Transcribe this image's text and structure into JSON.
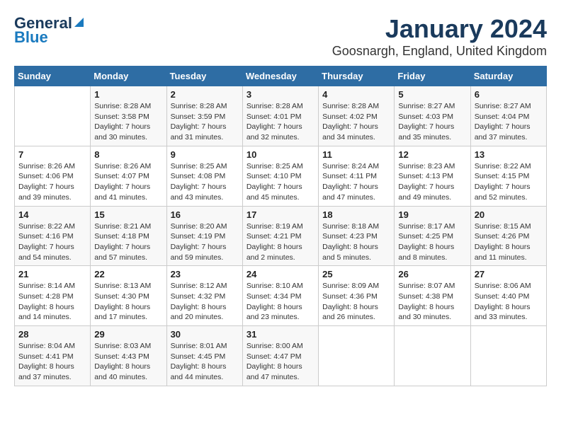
{
  "logo": {
    "line1": "General",
    "line2": "Blue"
  },
  "title": "January 2024",
  "subtitle": "Goosnargh, England, United Kingdom",
  "weekdays": [
    "Sunday",
    "Monday",
    "Tuesday",
    "Wednesday",
    "Thursday",
    "Friday",
    "Saturday"
  ],
  "weeks": [
    [
      {
        "day": "",
        "sunrise": "",
        "sunset": "",
        "daylight": ""
      },
      {
        "day": "1",
        "sunrise": "Sunrise: 8:28 AM",
        "sunset": "Sunset: 3:58 PM",
        "daylight": "Daylight: 7 hours and 30 minutes."
      },
      {
        "day": "2",
        "sunrise": "Sunrise: 8:28 AM",
        "sunset": "Sunset: 3:59 PM",
        "daylight": "Daylight: 7 hours and 31 minutes."
      },
      {
        "day": "3",
        "sunrise": "Sunrise: 8:28 AM",
        "sunset": "Sunset: 4:01 PM",
        "daylight": "Daylight: 7 hours and 32 minutes."
      },
      {
        "day": "4",
        "sunrise": "Sunrise: 8:28 AM",
        "sunset": "Sunset: 4:02 PM",
        "daylight": "Daylight: 7 hours and 34 minutes."
      },
      {
        "day": "5",
        "sunrise": "Sunrise: 8:27 AM",
        "sunset": "Sunset: 4:03 PM",
        "daylight": "Daylight: 7 hours and 35 minutes."
      },
      {
        "day": "6",
        "sunrise": "Sunrise: 8:27 AM",
        "sunset": "Sunset: 4:04 PM",
        "daylight": "Daylight: 7 hours and 37 minutes."
      }
    ],
    [
      {
        "day": "7",
        "sunrise": "Sunrise: 8:26 AM",
        "sunset": "Sunset: 4:06 PM",
        "daylight": "Daylight: 7 hours and 39 minutes."
      },
      {
        "day": "8",
        "sunrise": "Sunrise: 8:26 AM",
        "sunset": "Sunset: 4:07 PM",
        "daylight": "Daylight: 7 hours and 41 minutes."
      },
      {
        "day": "9",
        "sunrise": "Sunrise: 8:25 AM",
        "sunset": "Sunset: 4:08 PM",
        "daylight": "Daylight: 7 hours and 43 minutes."
      },
      {
        "day": "10",
        "sunrise": "Sunrise: 8:25 AM",
        "sunset": "Sunset: 4:10 PM",
        "daylight": "Daylight: 7 hours and 45 minutes."
      },
      {
        "day": "11",
        "sunrise": "Sunrise: 8:24 AM",
        "sunset": "Sunset: 4:11 PM",
        "daylight": "Daylight: 7 hours and 47 minutes."
      },
      {
        "day": "12",
        "sunrise": "Sunrise: 8:23 AM",
        "sunset": "Sunset: 4:13 PM",
        "daylight": "Daylight: 7 hours and 49 minutes."
      },
      {
        "day": "13",
        "sunrise": "Sunrise: 8:22 AM",
        "sunset": "Sunset: 4:15 PM",
        "daylight": "Daylight: 7 hours and 52 minutes."
      }
    ],
    [
      {
        "day": "14",
        "sunrise": "Sunrise: 8:22 AM",
        "sunset": "Sunset: 4:16 PM",
        "daylight": "Daylight: 7 hours and 54 minutes."
      },
      {
        "day": "15",
        "sunrise": "Sunrise: 8:21 AM",
        "sunset": "Sunset: 4:18 PM",
        "daylight": "Daylight: 7 hours and 57 minutes."
      },
      {
        "day": "16",
        "sunrise": "Sunrise: 8:20 AM",
        "sunset": "Sunset: 4:19 PM",
        "daylight": "Daylight: 7 hours and 59 minutes."
      },
      {
        "day": "17",
        "sunrise": "Sunrise: 8:19 AM",
        "sunset": "Sunset: 4:21 PM",
        "daylight": "Daylight: 8 hours and 2 minutes."
      },
      {
        "day": "18",
        "sunrise": "Sunrise: 8:18 AM",
        "sunset": "Sunset: 4:23 PM",
        "daylight": "Daylight: 8 hours and 5 minutes."
      },
      {
        "day": "19",
        "sunrise": "Sunrise: 8:17 AM",
        "sunset": "Sunset: 4:25 PM",
        "daylight": "Daylight: 8 hours and 8 minutes."
      },
      {
        "day": "20",
        "sunrise": "Sunrise: 8:15 AM",
        "sunset": "Sunset: 4:26 PM",
        "daylight": "Daylight: 8 hours and 11 minutes."
      }
    ],
    [
      {
        "day": "21",
        "sunrise": "Sunrise: 8:14 AM",
        "sunset": "Sunset: 4:28 PM",
        "daylight": "Daylight: 8 hours and 14 minutes."
      },
      {
        "day": "22",
        "sunrise": "Sunrise: 8:13 AM",
        "sunset": "Sunset: 4:30 PM",
        "daylight": "Daylight: 8 hours and 17 minutes."
      },
      {
        "day": "23",
        "sunrise": "Sunrise: 8:12 AM",
        "sunset": "Sunset: 4:32 PM",
        "daylight": "Daylight: 8 hours and 20 minutes."
      },
      {
        "day": "24",
        "sunrise": "Sunrise: 8:10 AM",
        "sunset": "Sunset: 4:34 PM",
        "daylight": "Daylight: 8 hours and 23 minutes."
      },
      {
        "day": "25",
        "sunrise": "Sunrise: 8:09 AM",
        "sunset": "Sunset: 4:36 PM",
        "daylight": "Daylight: 8 hours and 26 minutes."
      },
      {
        "day": "26",
        "sunrise": "Sunrise: 8:07 AM",
        "sunset": "Sunset: 4:38 PM",
        "daylight": "Daylight: 8 hours and 30 minutes."
      },
      {
        "day": "27",
        "sunrise": "Sunrise: 8:06 AM",
        "sunset": "Sunset: 4:40 PM",
        "daylight": "Daylight: 8 hours and 33 minutes."
      }
    ],
    [
      {
        "day": "28",
        "sunrise": "Sunrise: 8:04 AM",
        "sunset": "Sunset: 4:41 PM",
        "daylight": "Daylight: 8 hours and 37 minutes."
      },
      {
        "day": "29",
        "sunrise": "Sunrise: 8:03 AM",
        "sunset": "Sunset: 4:43 PM",
        "daylight": "Daylight: 8 hours and 40 minutes."
      },
      {
        "day": "30",
        "sunrise": "Sunrise: 8:01 AM",
        "sunset": "Sunset: 4:45 PM",
        "daylight": "Daylight: 8 hours and 44 minutes."
      },
      {
        "day": "31",
        "sunrise": "Sunrise: 8:00 AM",
        "sunset": "Sunset: 4:47 PM",
        "daylight": "Daylight: 8 hours and 47 minutes."
      },
      {
        "day": "",
        "sunrise": "",
        "sunset": "",
        "daylight": ""
      },
      {
        "day": "",
        "sunrise": "",
        "sunset": "",
        "daylight": ""
      },
      {
        "day": "",
        "sunrise": "",
        "sunset": "",
        "daylight": ""
      }
    ]
  ]
}
